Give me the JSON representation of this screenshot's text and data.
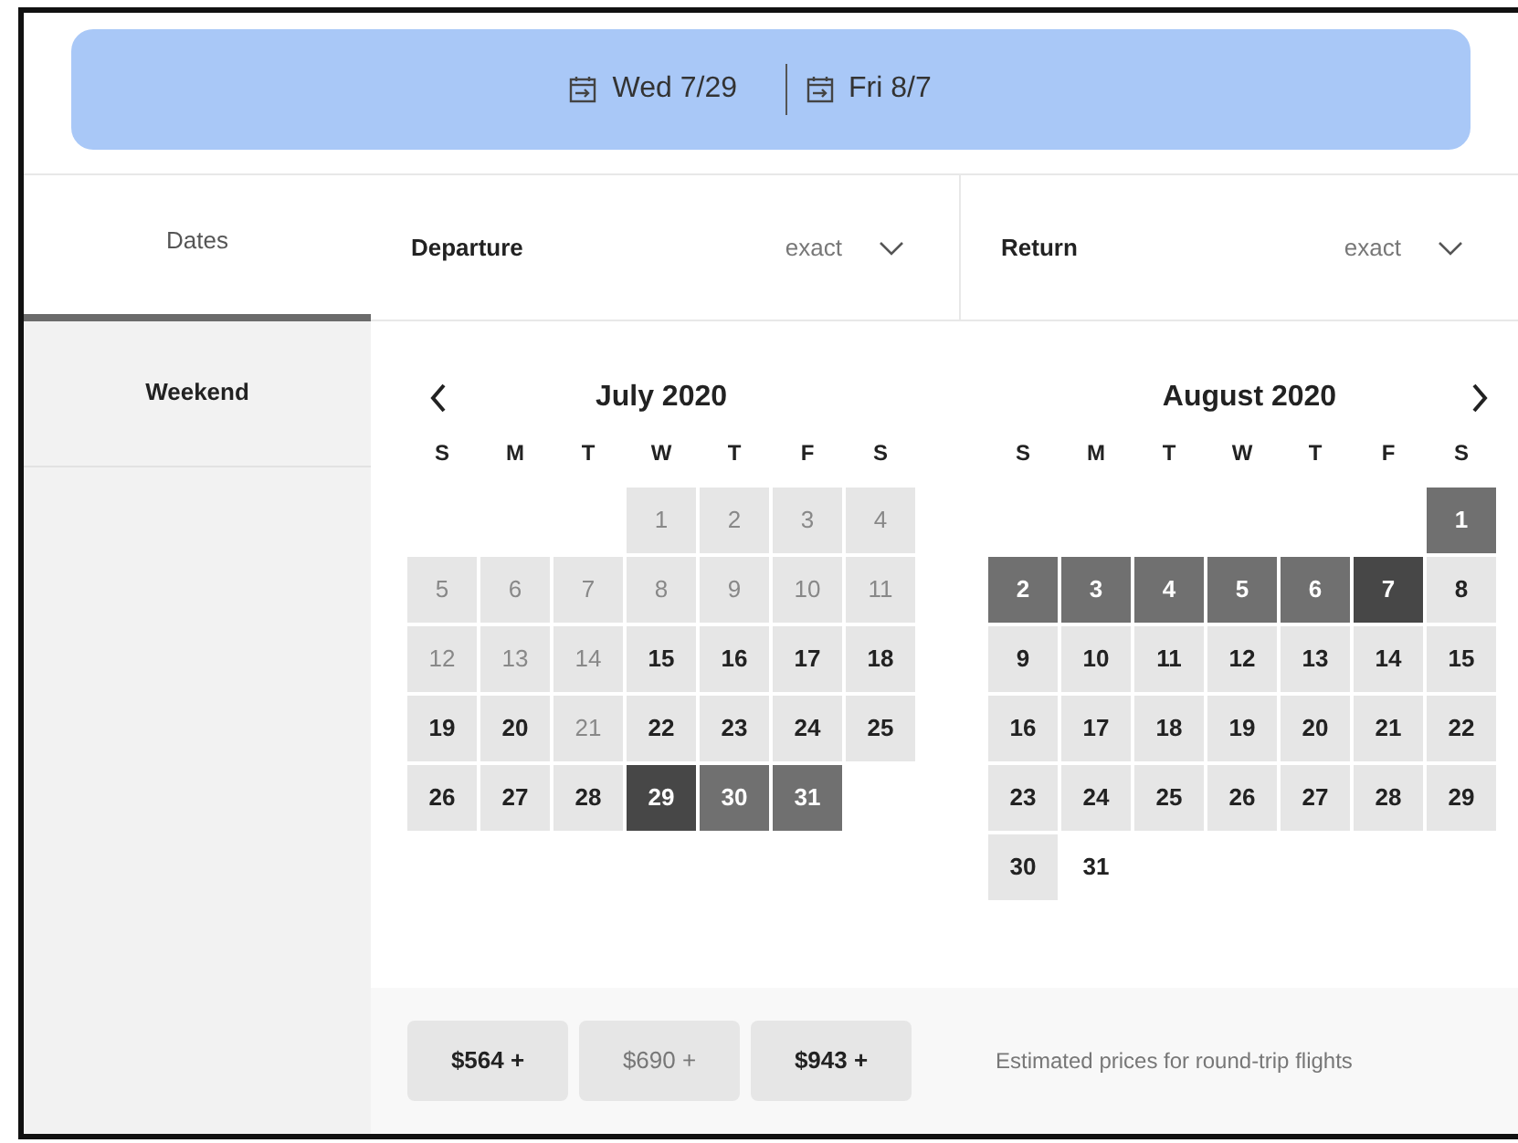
{
  "date_bar": {
    "departure": "Wed 7/29",
    "return": "Fri 8/7"
  },
  "tabs": [
    {
      "label": "Dates",
      "selected": true
    },
    {
      "label": "Weekend",
      "selected": false
    }
  ],
  "filters": [
    {
      "label": "Departure",
      "value": "exact"
    },
    {
      "label": "Return",
      "value": "exact"
    }
  ],
  "months": [
    {
      "title": "July 2020",
      "weekdays": [
        "S",
        "M",
        "T",
        "W",
        "T",
        "F",
        "S"
      ],
      "weeks": [
        [
          {
            "kind": "blank"
          },
          {
            "kind": "blank"
          },
          {
            "kind": "blank"
          },
          {
            "day": "1",
            "kind": "past"
          },
          {
            "day": "2",
            "kind": "past"
          },
          {
            "day": "3",
            "kind": "past"
          },
          {
            "day": "4",
            "kind": "past"
          }
        ],
        [
          {
            "day": "5",
            "kind": "past"
          },
          {
            "day": "6",
            "kind": "past"
          },
          {
            "day": "7",
            "kind": "past"
          },
          {
            "day": "8",
            "kind": "past"
          },
          {
            "day": "9",
            "kind": "past"
          },
          {
            "day": "10",
            "kind": "past"
          },
          {
            "day": "11",
            "kind": "past"
          }
        ],
        [
          {
            "day": "12",
            "kind": "past"
          },
          {
            "day": "13",
            "kind": "past"
          },
          {
            "day": "14",
            "kind": "past"
          },
          {
            "day": "15",
            "kind": "open"
          },
          {
            "day": "16",
            "kind": "open"
          },
          {
            "day": "17",
            "kind": "open"
          },
          {
            "day": "18",
            "kind": "open"
          }
        ],
        [
          {
            "day": "19",
            "kind": "open"
          },
          {
            "day": "20",
            "kind": "open"
          },
          {
            "day": "21",
            "kind": "past"
          },
          {
            "day": "22",
            "kind": "open"
          },
          {
            "day": "23",
            "kind": "open"
          },
          {
            "day": "24",
            "kind": "open"
          },
          {
            "day": "25",
            "kind": "open"
          }
        ],
        [
          {
            "day": "26",
            "kind": "open"
          },
          {
            "day": "27",
            "kind": "open"
          },
          {
            "day": "28",
            "kind": "open"
          },
          {
            "day": "29",
            "kind": "endpoint"
          },
          {
            "day": "30",
            "kind": "range"
          },
          {
            "day": "31",
            "kind": "range"
          }
        ]
      ]
    },
    {
      "title": "August 2020",
      "weekdays": [
        "S",
        "M",
        "T",
        "W",
        "T",
        "F",
        "S"
      ],
      "weeks": [
        [
          {
            "kind": "blank"
          },
          {
            "kind": "blank"
          },
          {
            "kind": "blank"
          },
          {
            "kind": "blank"
          },
          {
            "kind": "blank"
          },
          {
            "kind": "blank"
          },
          {
            "day": "1",
            "kind": "range"
          }
        ],
        [
          {
            "day": "2",
            "kind": "range"
          },
          {
            "day": "3",
            "kind": "range"
          },
          {
            "day": "4",
            "kind": "range"
          },
          {
            "day": "5",
            "kind": "range"
          },
          {
            "day": "6",
            "kind": "range"
          },
          {
            "day": "7",
            "kind": "endpoint"
          },
          {
            "day": "8",
            "kind": "open"
          }
        ],
        [
          {
            "day": "9",
            "kind": "open"
          },
          {
            "day": "10",
            "kind": "open"
          },
          {
            "day": "11",
            "kind": "open"
          },
          {
            "day": "12",
            "kind": "open"
          },
          {
            "day": "13",
            "kind": "open"
          },
          {
            "day": "14",
            "kind": "open"
          },
          {
            "day": "15",
            "kind": "open"
          }
        ],
        [
          {
            "day": "16",
            "kind": "open"
          },
          {
            "day": "17",
            "kind": "open"
          },
          {
            "day": "18",
            "kind": "open"
          },
          {
            "day": "19",
            "kind": "open"
          },
          {
            "day": "20",
            "kind": "open"
          },
          {
            "day": "21",
            "kind": "open"
          },
          {
            "day": "22",
            "kind": "open"
          }
        ],
        [
          {
            "day": "23",
            "kind": "open"
          },
          {
            "day": "24",
            "kind": "open"
          },
          {
            "day": "25",
            "kind": "open"
          },
          {
            "day": "26",
            "kind": "open"
          },
          {
            "day": "27",
            "kind": "open"
          },
          {
            "day": "28",
            "kind": "open"
          },
          {
            "day": "29",
            "kind": "open"
          }
        ],
        [
          {
            "day": "30",
            "kind": "open"
          },
          {
            "day": "31",
            "kind": "plain"
          }
        ]
      ]
    }
  ],
  "prices": [
    {
      "label": "$564 +",
      "muted": false
    },
    {
      "label": "$690 +",
      "muted": true
    },
    {
      "label": "$943 +",
      "muted": false
    }
  ],
  "note": "Estimated prices for round-trip flights"
}
